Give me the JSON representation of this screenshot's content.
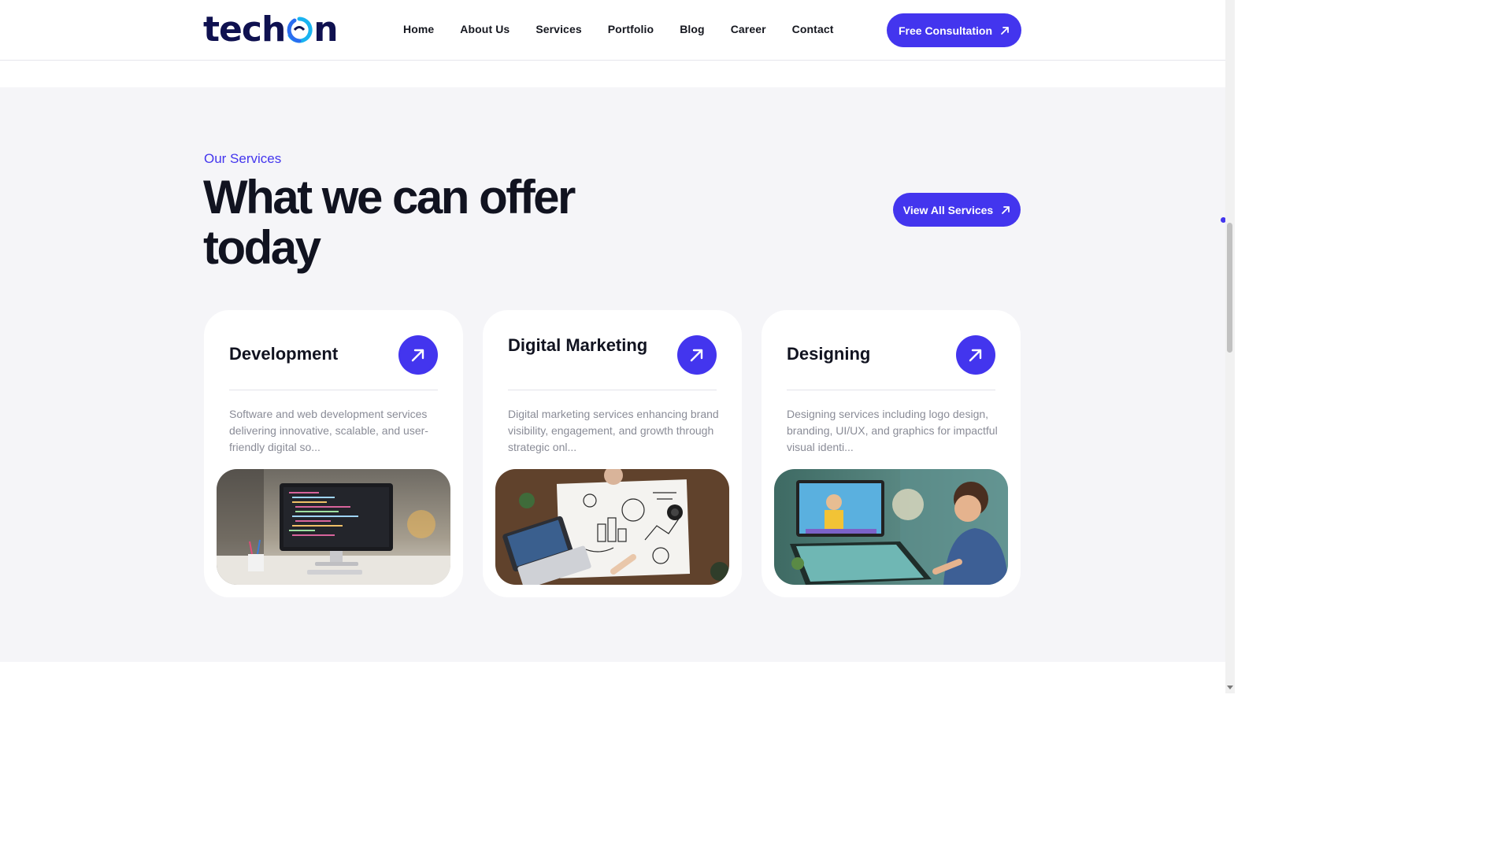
{
  "header": {
    "logo_text_left": "tech",
    "logo_text_right": "n",
    "nav": [
      "Home",
      "About Us",
      "Services",
      "Portfolio",
      "Blog",
      "Career",
      "Contact"
    ],
    "cta_label": "Free Consultation"
  },
  "services": {
    "eyebrow": "Our Services",
    "title": "What we can offer today",
    "view_all_label": "View All Services",
    "cards": [
      {
        "title": "Development",
        "description": "Software and web development services delivering innovative, scalable, and user-friendly digital so...",
        "image": "computer-code-photo"
      },
      {
        "title": "Digital Marketing",
        "description": "Digital marketing services enhancing brand visibility, engagement, and growth through strategic onl...",
        "image": "marketing-sketch-desk-photo"
      },
      {
        "title": "Designing",
        "description": "Designing services including logo design, branding, UI/UX, and graphics for impactful visual identi...",
        "image": "designer-at-tablet-photo"
      }
    ]
  },
  "colors": {
    "accent": "#4335ee",
    "logo_navy": "#0f1150",
    "logo_cyan": "#19b3f0",
    "section_bg": "#f5f5f8"
  },
  "icons": [
    "arrow-up-right-icon",
    "scroll-down-arrow-icon"
  ]
}
